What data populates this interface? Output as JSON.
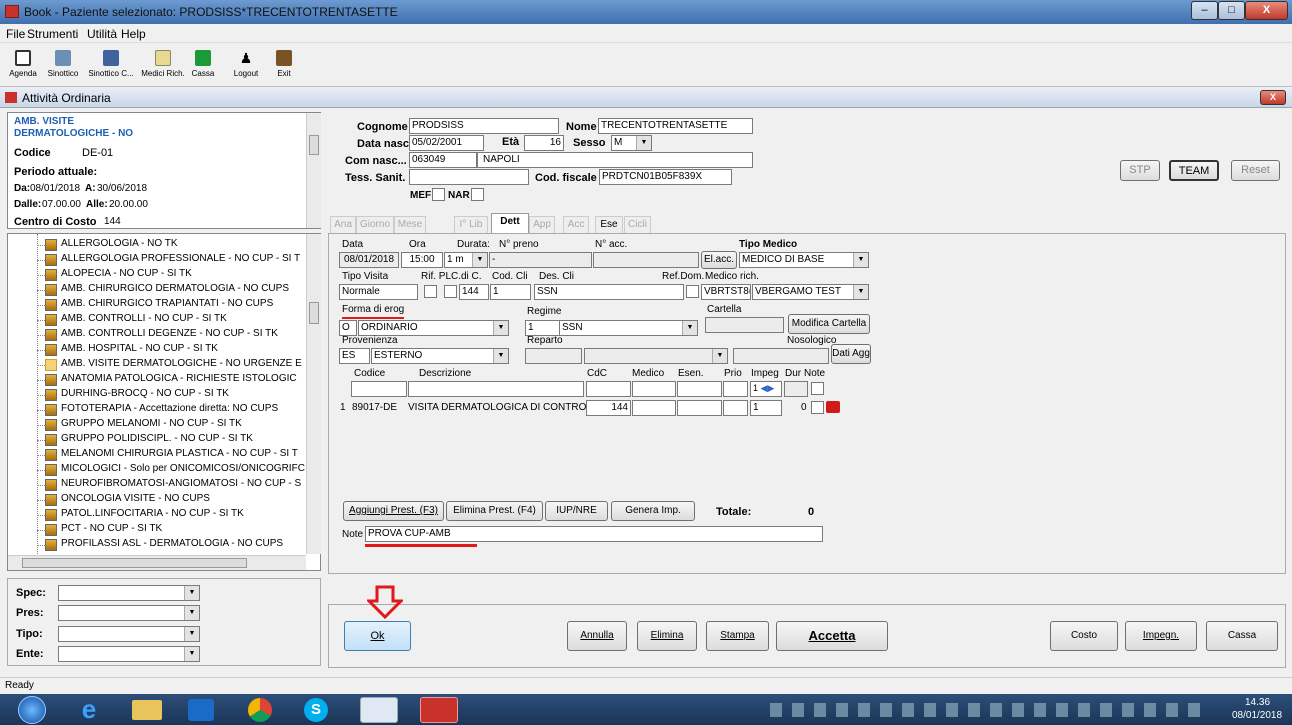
{
  "window": {
    "title": "Book - Paziente selezionato: PRODSISS*TRECENTOTRENTASETTE"
  },
  "menu": [
    "File",
    "Strumenti",
    "Utilità",
    "Help"
  ],
  "toolbar": [
    {
      "label": "Agenda",
      "icon": "agenda-icon"
    },
    {
      "label": "Sinottico",
      "icon": "sinottico-icon"
    },
    {
      "label": "Sinottico C...",
      "icon": "sinottico-c-icon"
    },
    {
      "label": "Medici Rich.",
      "icon": "medici-icon"
    },
    {
      "label": "Cassa",
      "icon": "cassa-icon"
    },
    {
      "label": "Logout",
      "icon": "logout-icon"
    },
    {
      "label": "Exit",
      "icon": "exit-icon"
    }
  ],
  "subwindow": {
    "title": "Attività Ordinaria"
  },
  "info": {
    "title1": "AMB. VISITE",
    "title2": "DERMATOLOGICHE - NO",
    "codice_label": "Codice",
    "codice_value": "DE-01",
    "periodo_label": "Periodo attuale:",
    "da_label": "Da:",
    "da_value": "08/01/2018",
    "a_label": "A:",
    "a_value": "30/06/2018",
    "dalle_label": "Dalle:",
    "dalle_value": "07.00.00",
    "alle_label": "Alle:",
    "alle_value": "20.00.00",
    "centro_label": "Centro di Costo",
    "centro_value": "144"
  },
  "tree": [
    {
      "label": "ALLERGOLOGIA - NO TK",
      "icon": "book"
    },
    {
      "label": "ALLERGOLOGIA PROFESSIONALE - NO CUP - SI T",
      "icon": "book"
    },
    {
      "label": "ALOPECIA - NO CUP - SI TK",
      "icon": "book"
    },
    {
      "label": "AMB. CHIRURGICO DERMATOLOGIA - NO CUPS",
      "icon": "book"
    },
    {
      "label": "AMB. CHIRURGICO TRAPIANTATI - NO CUPS",
      "icon": "book"
    },
    {
      "label": "AMB. CONTROLLI - NO CUP - SI TK",
      "icon": "book"
    },
    {
      "label": "AMB. CONTROLLI DEGENZE - NO CUP - SI TK",
      "icon": "book"
    },
    {
      "label": "AMB. HOSPITAL - NO CUP - SI TK",
      "icon": "book"
    },
    {
      "label": "AMB. VISITE DERMATOLOGICHE - NO URGENZE E",
      "icon": "fold"
    },
    {
      "label": "ANATOMIA PATOLOGICA - RICHIESTE ISTOLOGIC",
      "icon": "book"
    },
    {
      "label": "DURHING-BROCQ - NO CUP - SI TK",
      "icon": "book"
    },
    {
      "label": "FOTOTERAPIA - Accettazione diretta: NO CUPS",
      "icon": "book"
    },
    {
      "label": "GRUPPO MELANOMI - NO CUP - SI TK",
      "icon": "book"
    },
    {
      "label": "GRUPPO POLIDISCIPL. - NO CUP - SI TK",
      "icon": "book"
    },
    {
      "label": "MELANOMI CHIRURGIA PLASTICA - NO CUP - SI T",
      "icon": "book"
    },
    {
      "label": "MICOLOGICI - Solo per ONICOMICOSI/ONICOGRIFC",
      "icon": "book"
    },
    {
      "label": "NEUROFIBROMATOSI-ANGIOMATOSI - NO CUP - S",
      "icon": "book"
    },
    {
      "label": "ONCOLOGIA VISITE - NO CUPS",
      "icon": "book"
    },
    {
      "label": "PATOL.LINFOCITARIA - NO CUP - SI TK",
      "icon": "book"
    },
    {
      "label": "PCT - NO CUP - SI TK",
      "icon": "book"
    },
    {
      "label": "PROFILASSI ASL - DERMATOLOGIA - NO CUPS",
      "icon": "book"
    }
  ],
  "filters": {
    "spec": "Spec:",
    "pres": "Pres:",
    "tipo": "Tipo:",
    "ente": "Ente:"
  },
  "patient": {
    "cognome_label": "Cognome",
    "cognome": "PRODSISS",
    "nome_label": "Nome",
    "nome": "TRECENTOTRENTASETTE",
    "datanasc_label": "Data nasc",
    "datanasc": "05/02/2001",
    "eta_label": "Età",
    "eta": "16",
    "sesso_label": "Sesso",
    "sesso": "M",
    "comnasc_label": "Com nasc...",
    "comnasc_code": "063049",
    "comnasc_name": "NAPOLI",
    "tess_label": "Tess. Sanit.",
    "tess": "",
    "codfisc_label": "Cod. fiscale",
    "codfisc": "PRDTCN01B05F839X",
    "mef_label": "MEF",
    "nar_label": "NAR"
  },
  "top_buttons": {
    "stp": "STP",
    "team": "TEAM",
    "reset": "Reset"
  },
  "tabs": [
    "Ana",
    "Giorno",
    "Mese",
    "I° Lib",
    "Dett",
    "App",
    "Acc",
    "Ese",
    "Cicli"
  ],
  "detail": {
    "data_label": "Data",
    "data": "08/01/2018",
    "ora_label": "Ora",
    "ora": "15:00",
    "durata_label": "Durata:",
    "durata": "1",
    "npreno_label": "N° preno",
    "npreno": "-",
    "nacc_label": "N° acc.",
    "elacc": "El.acc.",
    "tipomedico_label": "Tipo Medico",
    "tipomedico": "MEDICO DI BASE",
    "tipovisita_label": "Tipo Visita",
    "tipovisita": "Normale",
    "rifpl_label": "Rif. PL",
    "cdic_label": "C.di C.",
    "cdic": "144",
    "codcli_label": "Cod. Cli",
    "codcli": "1",
    "descli_label": "Des. Cli",
    "descli": "SSN",
    "refdom_label": "Ref.Dom.",
    "medicorich_label": "Medico rich.",
    "medicorich_code": "VBRTST8(",
    "medicorich_name": "VBERGAMO TEST",
    "forma_label": "Forma di erog",
    "forma_code": "O",
    "forma": "ORDINARIO",
    "regime_label": "Regime",
    "regime_code": "1",
    "regime": "SSN",
    "cartella_label": "Cartella",
    "modcartella": "Modifica Cartella",
    "prov_label": "Provenienza",
    "prov_code": "ES",
    "prov": "ESTERNO",
    "reparto_label": "Reparto",
    "noso_label": "Nosologico",
    "datiagg": "Dati Agg"
  },
  "grid": {
    "headers": [
      "Codice",
      "Descrizione",
      "CdC",
      "Medico",
      "Esen.",
      "Prio",
      "Impeg",
      "Dur",
      "Note"
    ],
    "impeg_value": "1",
    "row": {
      "n": "1",
      "codice": "89017-DE",
      "descrizione": "VISITA DERMATOLOGICA DI CONTROL",
      "cdc": "144",
      "impeg": "1",
      "dur": "0"
    }
  },
  "actions": {
    "aggiungi": "Aggiungi Prest. (F3)",
    "elimina": "Elimina Prest. (F4)",
    "iup": "IUP/NRE",
    "genera": "Genera Imp.",
    "totale_label": "Totale:",
    "totale": "0",
    "note_label": "Note",
    "note": "PROVA CUP-AMB"
  },
  "bottom_buttons": {
    "ok": "Ok",
    "annulla": "Annulla",
    "elimina": "Elimina",
    "stampa": "Stampa",
    "accetta": "Accetta",
    "costo": "Costo",
    "impegn": "Impegn.",
    "cassa": "Cassa"
  },
  "status": "Ready",
  "clock": {
    "time": "14.36",
    "date": "08/01/2018"
  },
  "colors": {
    "accent_red": "#e0191c",
    "highlight_blue": "#1d5fb5",
    "selected_tab": "#ffffff"
  }
}
